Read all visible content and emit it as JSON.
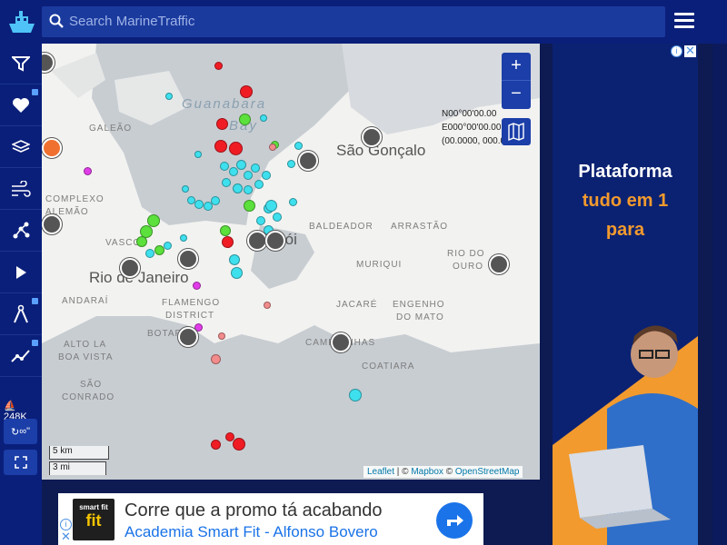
{
  "app": {
    "search_placeholder": "Search MarineTraffic"
  },
  "sidebar": {
    "items": [
      {
        "icon": "filter-icon",
        "locked": false
      },
      {
        "icon": "heart-icon",
        "locked": true
      },
      {
        "icon": "layers-icon",
        "locked": false
      },
      {
        "icon": "wind-icon",
        "locked": false
      },
      {
        "icon": "network-icon",
        "locked": false
      },
      {
        "icon": "play-icon",
        "locked": false
      },
      {
        "icon": "compass-icon",
        "locked": true
      },
      {
        "icon": "chart-line-icon",
        "locked": true
      }
    ],
    "vessel_count": "248K",
    "refresh_label": "∞\""
  },
  "map": {
    "coords": {
      "lat": "N00°00'00.00",
      "lon": "E000°00'00.00",
      "decimal": "(00.0000, 000.0000)"
    },
    "zoom_in": "+",
    "zoom_out": "−",
    "labels": {
      "bay_line1": "Guanabara",
      "bay_line2": "Bay",
      "galeao": "GALEÃO",
      "complexo": "COMPLEXO",
      "alemao": "ALEMÃO",
      "vasco": "VASCO",
      "andarai": "ANDARAÍ",
      "flamengo": "FLAMENGO",
      "district": "DISTRICT",
      "botafogo": "BOTAFO",
      "alto": "ALTO LA",
      "boa_vista": "BOA VISTA",
      "sao_conrado": "SÃO",
      "conrado": "CONRADO",
      "baldeador": "BALDEADOR",
      "arrastao": "ARRASTÃO",
      "rio_do": "RIO DO",
      "ouro": "OURO",
      "muriqui": "MURIQUI",
      "jacare": "JACARÉ",
      "engenho": "ENGENHO",
      "do_mato": "DO MATO",
      "camboinhas": "CAMBOINHAS",
      "itacoatiara": "COATIARA",
      "niteroi": "rói"
    },
    "cities": {
      "sao_goncalo": "São Gonçalo",
      "rio": "Rio de Janeiro"
    },
    "scale": {
      "km": "5 km",
      "mi": "3 mi"
    },
    "attribution": {
      "leaflet": "Leaflet",
      "sep1": " | © ",
      "mapbox": "Mapbox",
      "sep2": " © ",
      "osm": "OpenStreetMap"
    }
  },
  "ads": {
    "side": {
      "line1": "Plataforma",
      "line2": "tudo em 1",
      "line3": "para"
    },
    "bottom": {
      "brand": "smart fit",
      "headline": "Corre que a promo tá acabando",
      "subline": "Academia Smart Fit - Alfonso Bovero"
    },
    "info": "i",
    "close": "✕"
  },
  "colors": {
    "nav": "#0a1f7a",
    "cargo": "#3fe0ee",
    "tanker": "#f01c24",
    "passenger": "#5be03c",
    "pleasure": "#e03ce8"
  }
}
